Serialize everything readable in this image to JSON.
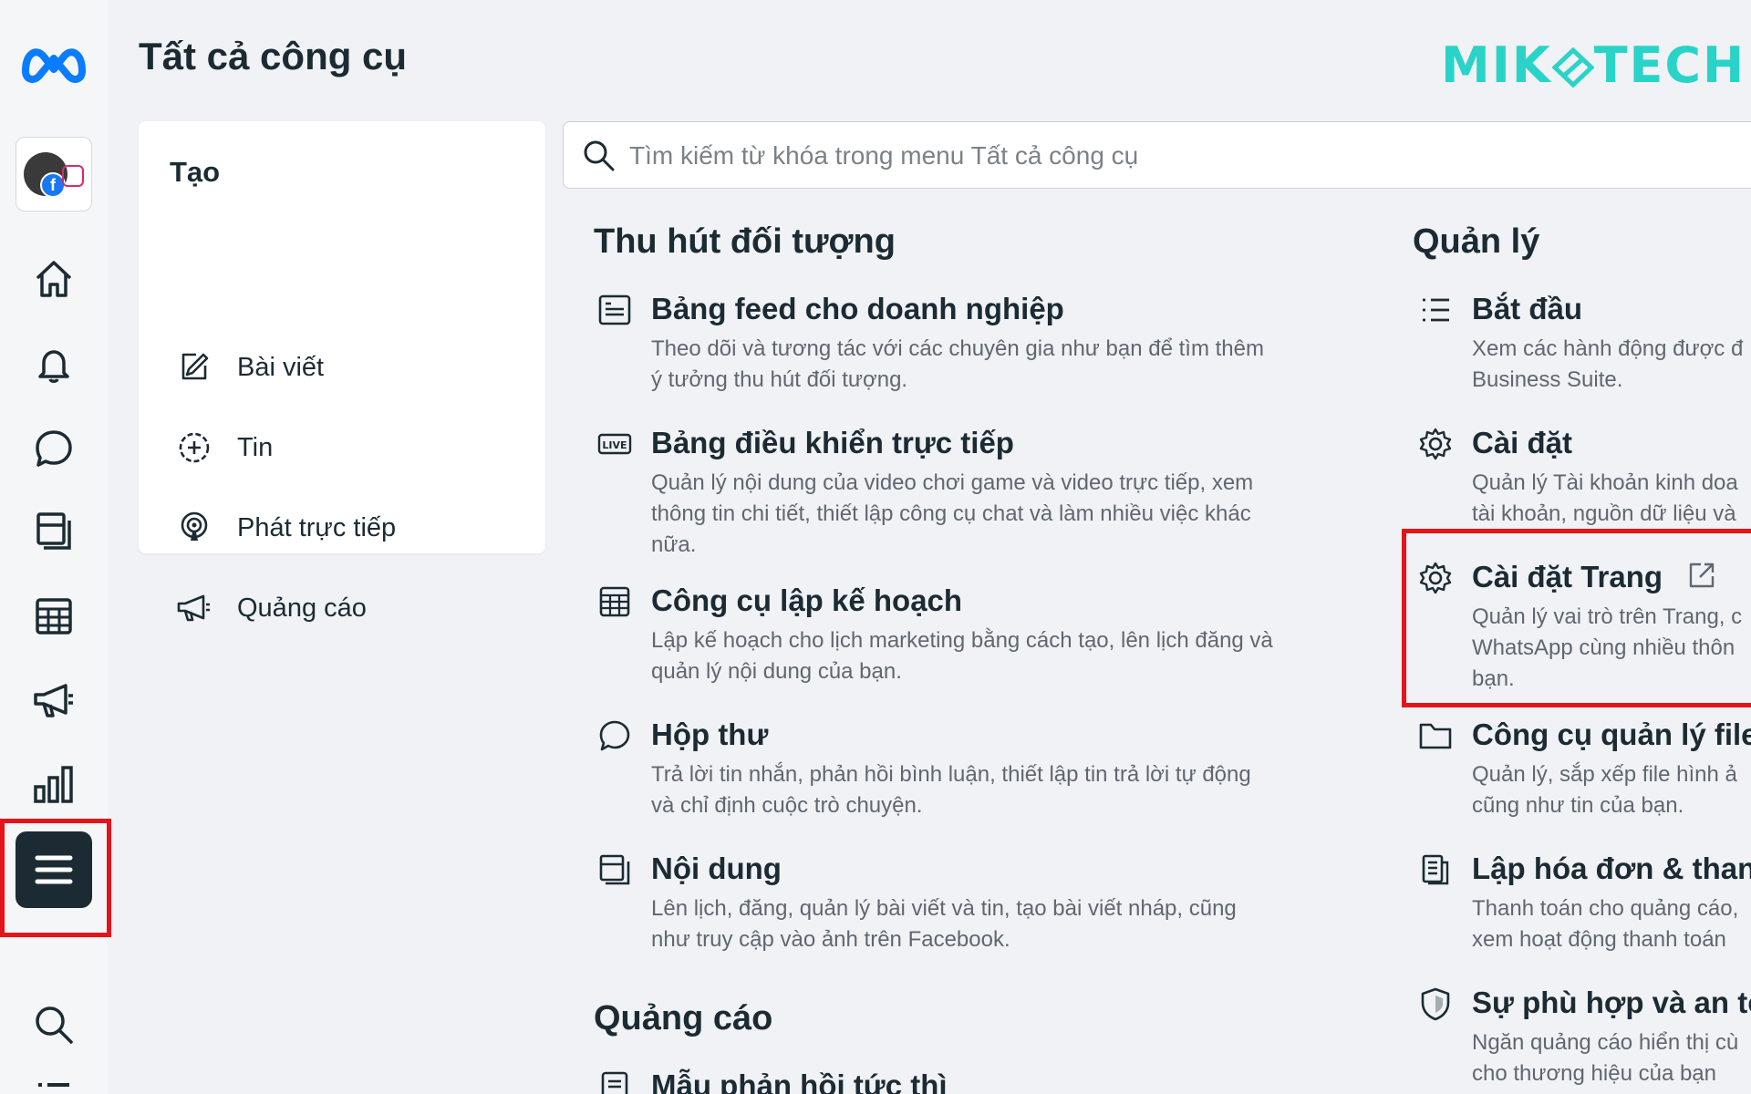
{
  "page": {
    "title": "Tất cả công cụ",
    "logo_text": "MIK",
    "logo_text2": "TECH"
  },
  "search": {
    "placeholder": "Tìm kiếm từ khóa trong menu Tất cả công cụ"
  },
  "create": {
    "heading": "Tạo",
    "items": [
      {
        "label": "Bài viết",
        "icon": "edit-icon"
      },
      {
        "label": "Tin",
        "icon": "add-circle-icon"
      },
      {
        "label": "Phát trực tiếp",
        "icon": "live-broadcast-icon"
      },
      {
        "label": "Quảng cáo",
        "icon": "megaphone-icon"
      }
    ]
  },
  "engage": {
    "heading": "Thu hút đối tượng",
    "items": [
      {
        "title": "Bảng feed cho doanh nghiệp",
        "desc": [
          "Theo dõi và tương tác với các chuyên gia như bạn để tìm thêm",
          "ý tưởng thu hút đối tượng."
        ]
      },
      {
        "title": "Bảng điều khiển trực tiếp",
        "desc": [
          "Quản lý nội dung của video chơi game và video trực tiếp, xem",
          "thông tin chi tiết, thiết lập công cụ chat và làm nhiều việc khác",
          "nữa."
        ]
      },
      {
        "title": "Công cụ lập kế hoạch",
        "desc": [
          "Lập kế hoạch cho lịch marketing bằng cách tạo, lên lịch đăng và",
          "quản lý nội dung của bạn."
        ]
      },
      {
        "title": "Hộp thư",
        "desc": [
          "Trả lời tin nhắn, phản hồi bình luận, thiết lập tin trả lời tự động",
          "và chỉ định cuộc trò chuyện."
        ]
      },
      {
        "title": "Nội dung",
        "desc": [
          "Lên lịch, đăng, quản lý bài viết và tin, tạo bài viết nháp, cũng",
          "như truy cập vào ảnh trên Facebook."
        ]
      }
    ]
  },
  "ads": {
    "heading": "Quảng cáo",
    "items": [
      {
        "title": "Mẫu phản hồi tức thì"
      }
    ]
  },
  "manage": {
    "heading": "Quản lý",
    "items": [
      {
        "title": "Bắt đầu",
        "desc": [
          "Xem các hành động được đ",
          "Business Suite."
        ]
      },
      {
        "title": "Cài đặt",
        "desc": [
          "Quản lý Tài khoản kinh doa",
          "tài khoản, nguồn dữ liệu và"
        ]
      },
      {
        "title": "Cài đặt Trang",
        "desc": [
          "Quản lý vai trò trên Trang, c",
          "WhatsApp cùng nhiều thôn",
          "bạn."
        ]
      },
      {
        "title": "Công cụ quản lý file",
        "desc": [
          "Quản lý, sắp xếp file hình ả",
          "cũng như tin của bạn."
        ]
      },
      {
        "title": "Lập hóa đơn & than",
        "desc": [
          "Thanh toán cho quảng cáo,",
          "xem hoạt động thanh toán"
        ]
      },
      {
        "title": "Sự phù hợp và an to",
        "desc": [
          "Ngăn quảng cáo hiển thị cù",
          "cho thương hiệu của bạn"
        ]
      }
    ]
  }
}
